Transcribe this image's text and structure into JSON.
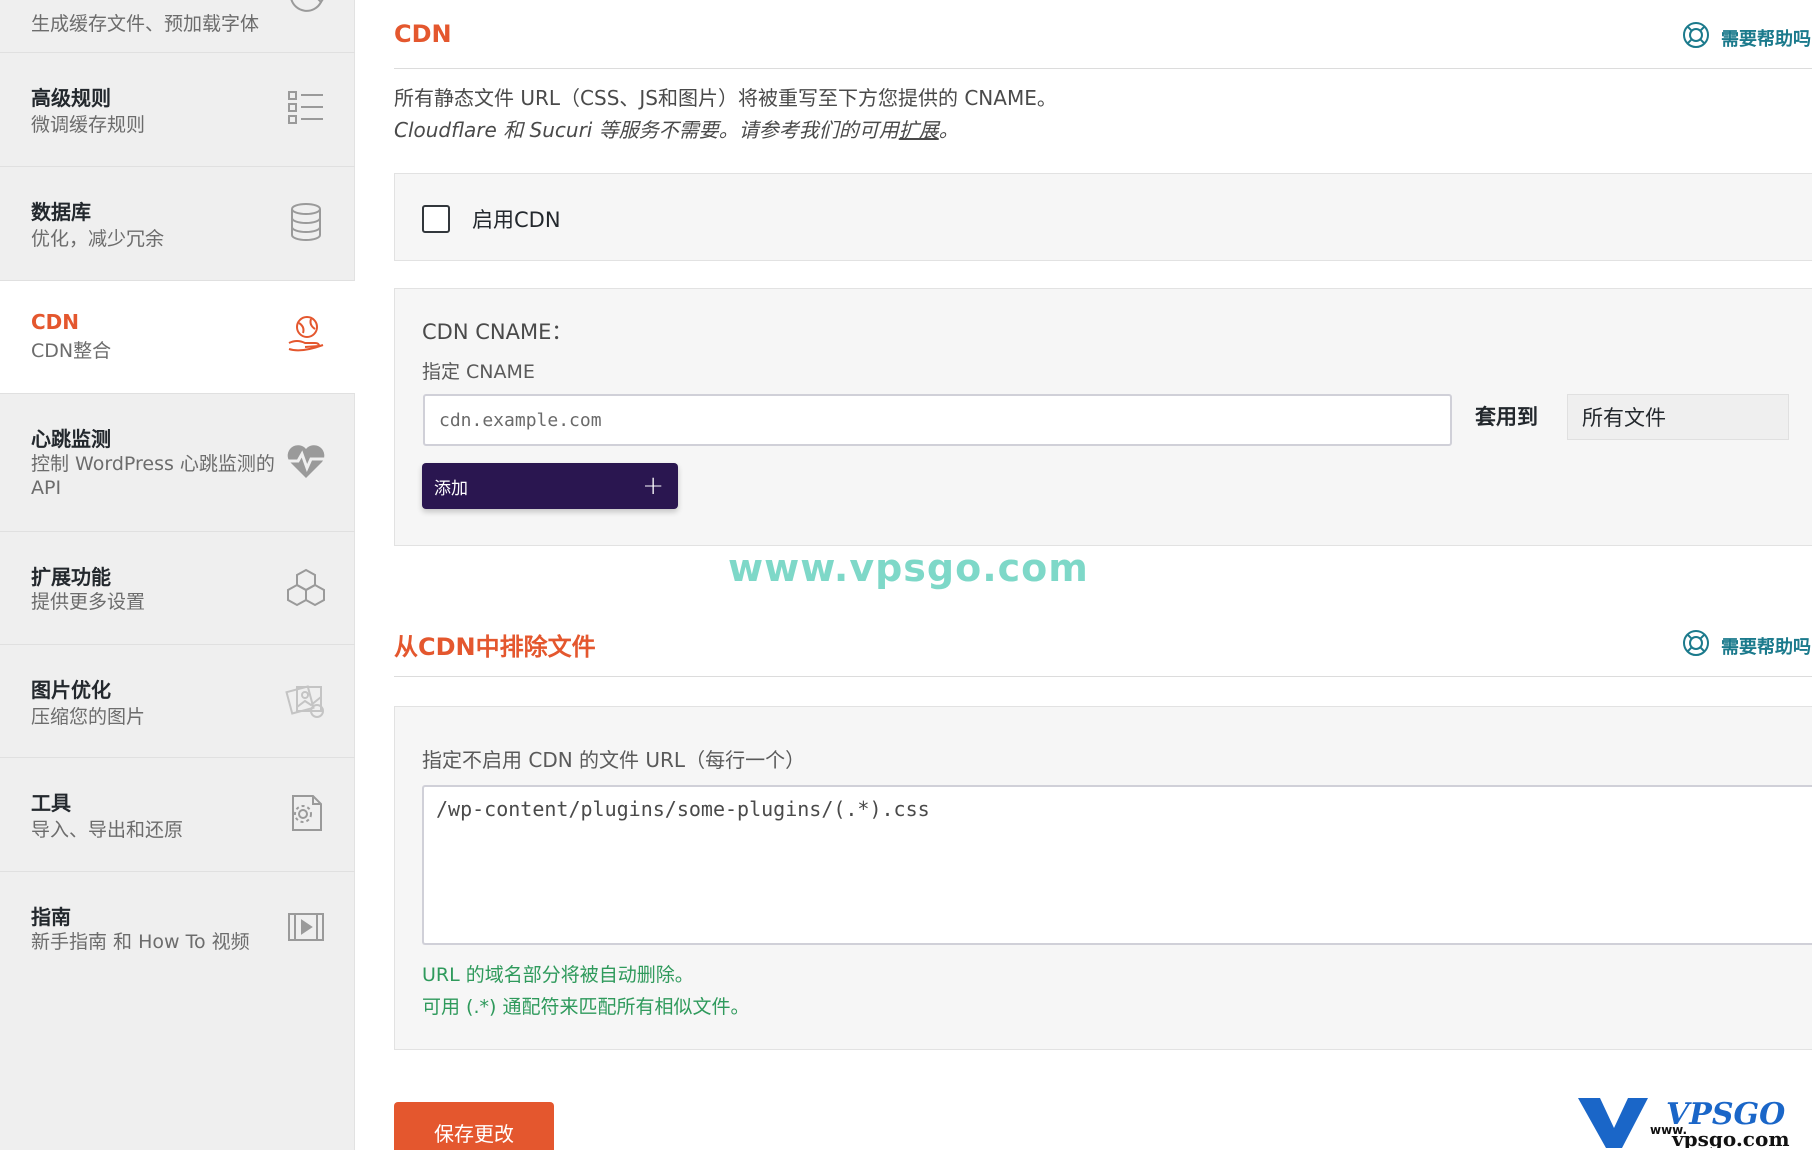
{
  "sidebar": {
    "items": [
      {
        "title": "",
        "sub": "生成缓存文件、预加载字体",
        "icon": "refresh-icon"
      },
      {
        "title": "高级规则",
        "sub": "微调缓存规则",
        "icon": "list-icon"
      },
      {
        "title": "数据库",
        "sub": "优化，减少冗余",
        "icon": "database-icon"
      },
      {
        "title": "CDN",
        "sub": "CDN整合",
        "icon": "cdn-hand-globe-icon"
      },
      {
        "title": "心跳监测",
        "sub": "控制 WordPress 心跳监测的 API",
        "icon": "heartbeat-icon"
      },
      {
        "title": "扩展功能",
        "sub": "提供更多设置",
        "icon": "cubes-icon"
      },
      {
        "title": "图片优化",
        "sub": "压缩您的图片",
        "icon": "images-icon"
      },
      {
        "title": "工具",
        "sub": "导入、导出和还原",
        "icon": "file-gear-icon"
      },
      {
        "title": "指南",
        "sub": "新手指南 和 How To 视频",
        "icon": "video-icon"
      }
    ]
  },
  "cdn_section": {
    "title": "CDN",
    "help": "需要帮助吗",
    "desc_line1": "所有静态文件 URL（CSS、JS和图片）将被重写至下方您提供的 CNAME。",
    "desc_line2_pre": "Cloudflare 和 Sucuri 等服务不需要。请参考我们的可用",
    "desc_line2_link": "扩展",
    "desc_line2_post": "。",
    "enable_label": "启用CDN",
    "cname_title": "CDN CNAME：",
    "cname_sub": "指定 CNAME",
    "cname_placeholder": "cdn.example.com",
    "apply_to_label": "套用到",
    "apply_to_value": "所有文件",
    "add_label": "添加",
    "add_symbol": "+"
  },
  "watermark": "www.vpsgo.com",
  "exclude_section": {
    "title": "从CDN中排除文件",
    "help": "需要帮助吗",
    "field_label": "指定不启用 CDN 的文件 URL（每行一个）",
    "textarea_placeholder": "/wp-content/plugins/some-plugins/(.*).css",
    "hint1": "URL 的域名部分将被自动删除。",
    "hint2": "可用 (.*) 通配符来匹配所有相似文件。"
  },
  "save_label": "保存更改",
  "logo": {
    "brand": "VPSGO",
    "small": "www.",
    "domain": "vpsgo.com",
    "color": "#1a66c8"
  },
  "colors": {
    "accent": "#e4572e",
    "button_dark": "#2a1650",
    "help": "#1b7a8c",
    "hint": "#2f9a5c"
  }
}
